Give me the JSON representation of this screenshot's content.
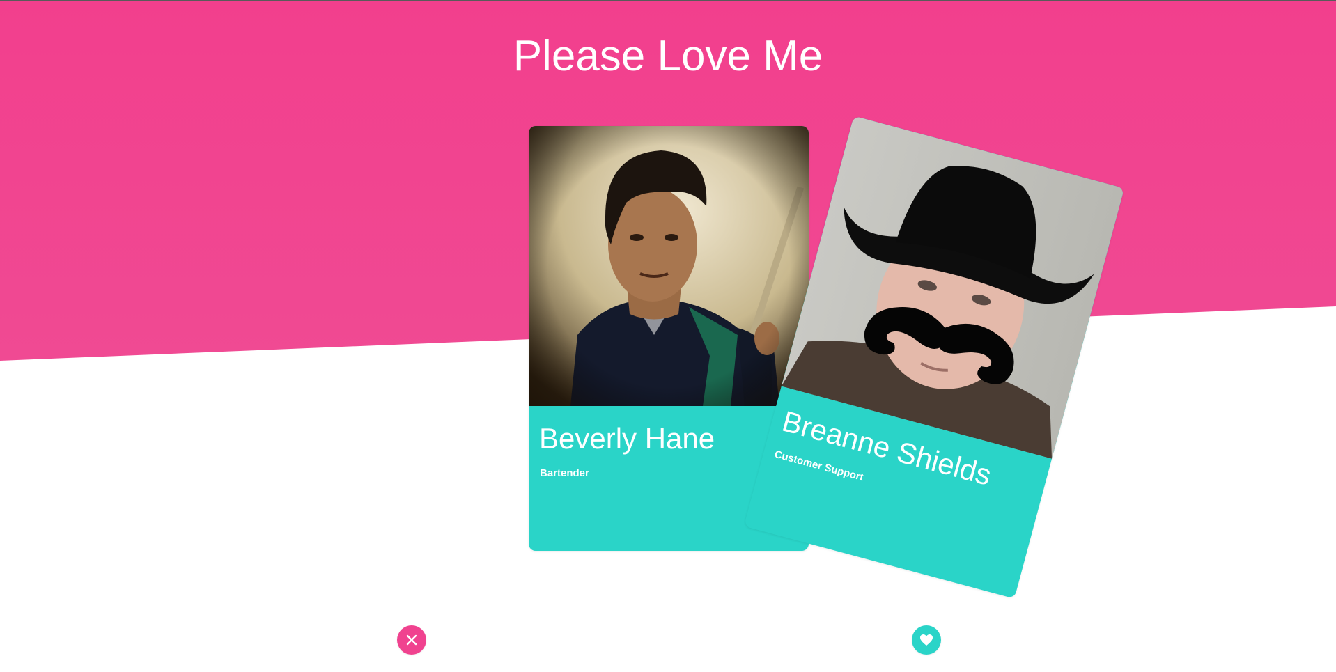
{
  "app": {
    "title": "Please Love Me"
  },
  "theme": {
    "primary_pink": "#f0428f",
    "accent_teal": "#2ad4c8",
    "text_on_color": "#ffffff"
  },
  "cards": [
    {
      "name": "Beverly Hane",
      "role": "Bartender",
      "photo_icon": "profile-photo"
    },
    {
      "name": "Breanne Shields",
      "role": "Customer Support",
      "photo_icon": "profile-photo"
    }
  ],
  "actions": {
    "dislike_icon": "close-icon",
    "like_icon": "heart-icon"
  }
}
